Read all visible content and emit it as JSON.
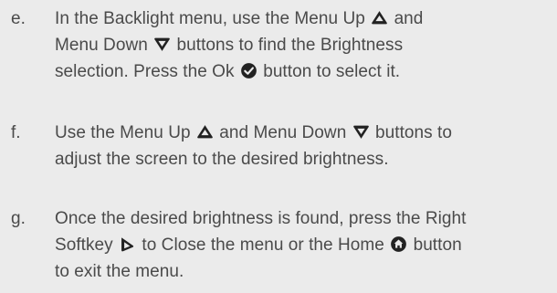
{
  "steps": [
    {
      "letter": "e.",
      "lines": [
        [
          "In the Backlight menu, use the Menu Up",
          "and"
        ],
        [
          "Menu Down",
          "buttons to find the Brightness"
        ],
        [
          "selection. Press the Ok",
          "button to select it."
        ]
      ],
      "icons": [
        "menu-up-icon",
        "menu-down-icon",
        "ok-icon"
      ]
    },
    {
      "letter": "f.",
      "lines": [
        [
          "Use the Menu Up",
          "and Menu Down",
          "buttons to"
        ],
        [
          "adjust the screen to the desired brightness."
        ]
      ],
      "icons": [
        "menu-up-icon",
        "menu-down-icon"
      ]
    },
    {
      "letter": "g.",
      "lines": [
        [
          "Once the desired brightness is found, press the Right"
        ],
        [
          "Softkey",
          "to Close the menu or the Home",
          "button"
        ],
        [
          "to exit the menu."
        ]
      ],
      "icons": [
        "right-softkey-icon",
        "home-icon"
      ]
    }
  ],
  "colors": {
    "background": "#ebebeb",
    "text": "#4a4a4a",
    "icon": "#222222"
  }
}
